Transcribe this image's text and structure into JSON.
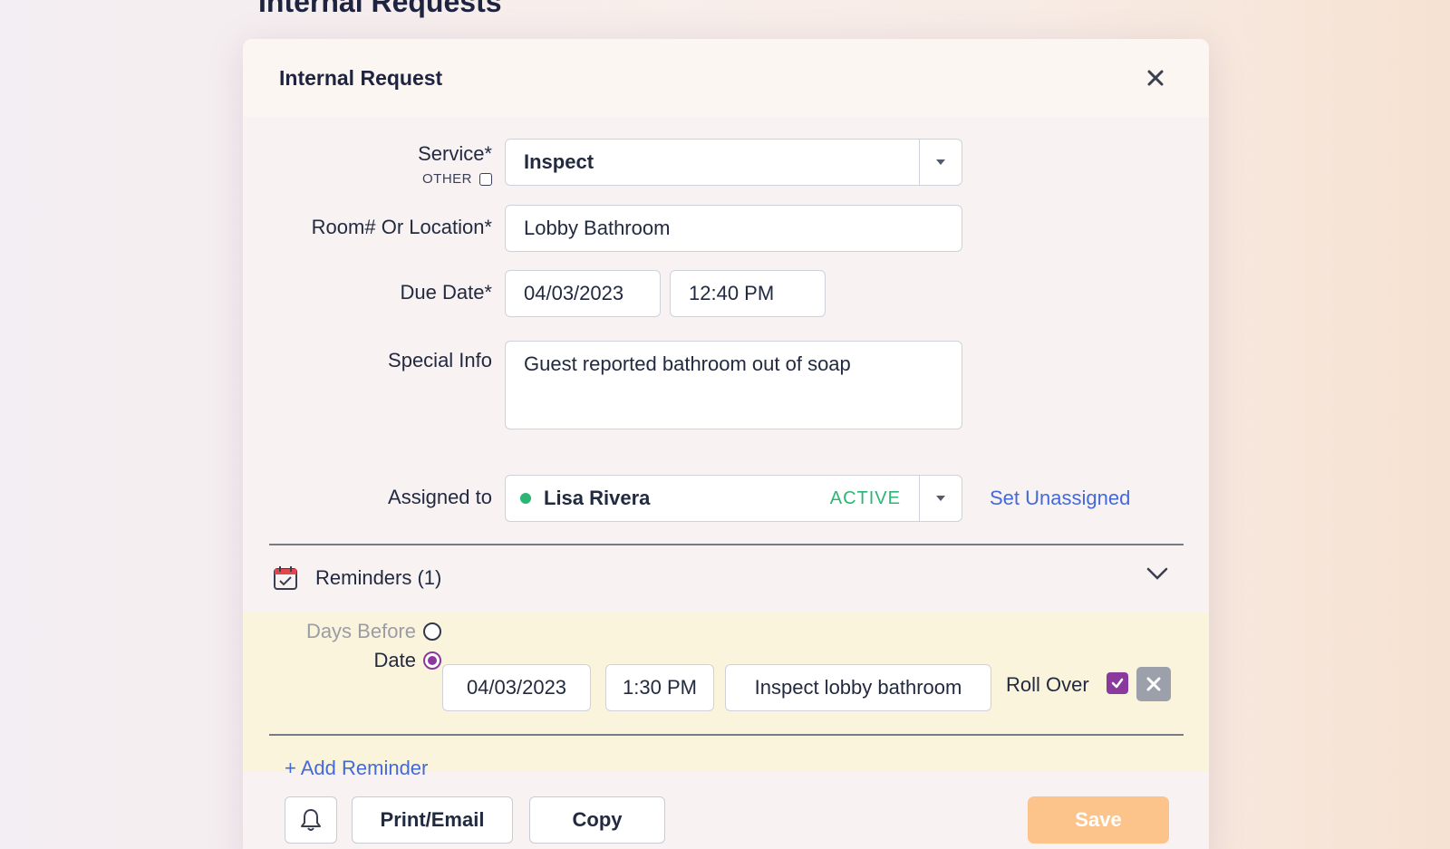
{
  "page": {
    "heading": "Internal Requests"
  },
  "modal": {
    "title": "Internal Request",
    "close_icon": "close-icon"
  },
  "form": {
    "service": {
      "label": "Service*",
      "other_label": "OTHER",
      "other_checked": false,
      "value": "Inspect"
    },
    "location": {
      "label": "Room# Or Location*",
      "value": "Lobby Bathroom"
    },
    "due_date": {
      "label": "Due Date*",
      "date": "04/03/2023",
      "time": "12:40 PM"
    },
    "special_info": {
      "label": "Special Info",
      "value": "Guest reported bathroom out of soap"
    },
    "assigned_to": {
      "label": "Assigned to",
      "name": "Lisa Rivera",
      "status": "ACTIVE",
      "status_color": "#2bb673",
      "unassign_link": "Set Unassigned"
    }
  },
  "reminders": {
    "title": "Reminders (1)",
    "icon": "calendar-check-icon",
    "items": [
      {
        "days_before_label": "Days Before",
        "date_label": "Date",
        "mode": "Date",
        "date": "04/03/2023",
        "time": "1:30 PM",
        "message": "Inspect lobby bathroom",
        "rollover_label": "Roll Over",
        "rollover_checked": true
      }
    ],
    "add_link": "+ Add Reminder"
  },
  "footer": {
    "bell_icon": "bell-icon",
    "print_label": "Print/Email",
    "copy_label": "Copy",
    "save_label": "Save"
  },
  "colors": {
    "accent_link": "#4469d8",
    "save_button": "#fcc48a",
    "checkbox_purple": "#8a3a9c",
    "reminder_panel": "#fbf4dd"
  }
}
